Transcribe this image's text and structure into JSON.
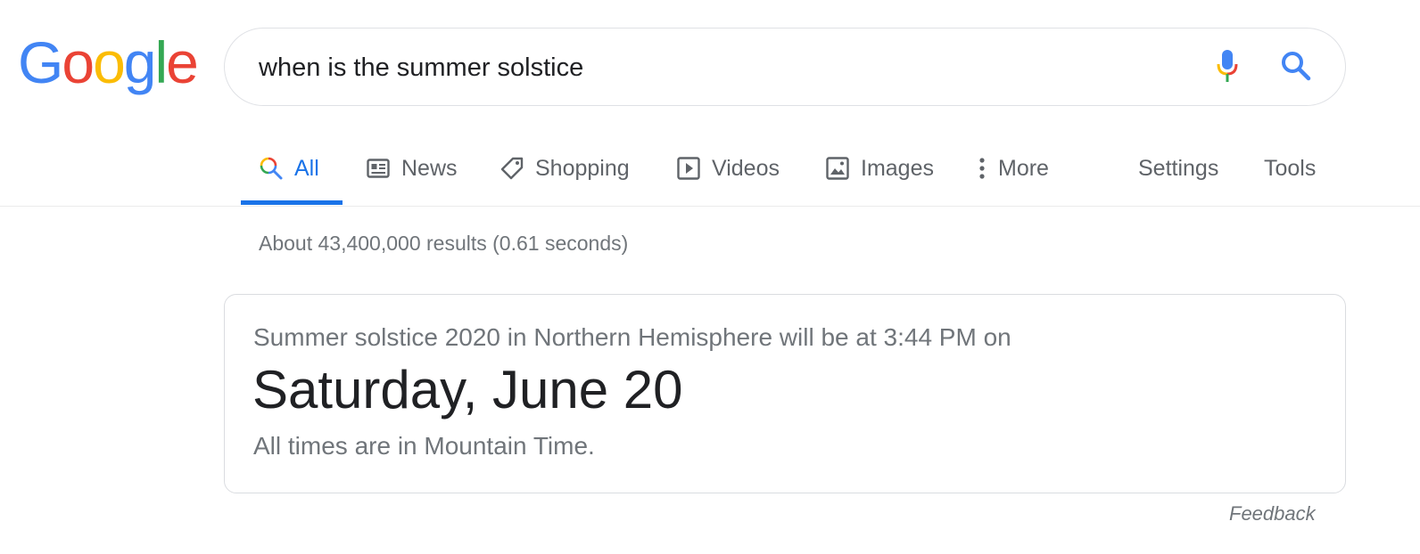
{
  "logo": {
    "letters": [
      "G",
      "o",
      "o",
      "g",
      "l",
      "e"
    ],
    "colors": [
      "#4285F4",
      "#EA4335",
      "#FBBC05",
      "#4285F4",
      "#34A853",
      "#EA4335"
    ]
  },
  "search": {
    "query": "when is the summer solstice",
    "mic_icon": "microphone-icon",
    "search_icon": "magnifier-icon"
  },
  "tabs": [
    {
      "label": "All",
      "icon": "search-color-icon",
      "active": true
    },
    {
      "label": "News",
      "icon": "news-icon",
      "active": false
    },
    {
      "label": "Shopping",
      "icon": "tag-icon",
      "active": false
    },
    {
      "label": "Videos",
      "icon": "play-icon",
      "active": false
    },
    {
      "label": "Images",
      "icon": "image-icon",
      "active": false
    },
    {
      "label": "More",
      "icon": "vertical-dots-icon",
      "active": false
    }
  ],
  "tools": {
    "settings_label": "Settings",
    "tools_label": "Tools"
  },
  "result_stats": "About 43,400,000 results (0.61 seconds)",
  "answer": {
    "subtitle": "Summer solstice 2020 in Northern Hemisphere will be at 3:44 PM on",
    "date": "Saturday, June 20",
    "note": "All times are in Mountain Time."
  },
  "feedback_label": "Feedback",
  "colors": {
    "accent": "#1a73e8",
    "tab_text": "#5f6368",
    "secondary_text": "#70757a"
  }
}
